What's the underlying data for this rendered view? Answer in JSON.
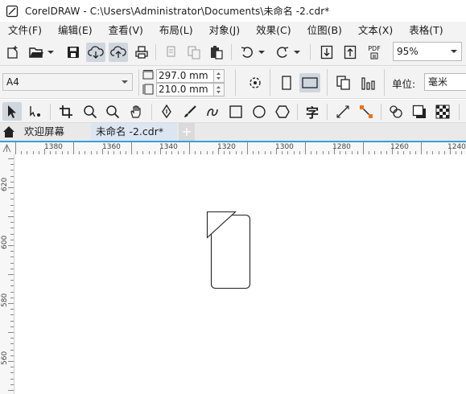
{
  "window": {
    "title": "CorelDRAW - C:\\Users\\Administrator\\Documents\\未命名 -2.cdr*"
  },
  "menu": [
    {
      "label": "文件(F)"
    },
    {
      "label": "编辑(E)"
    },
    {
      "label": "查看(V)"
    },
    {
      "label": "布局(L)"
    },
    {
      "label": "对象(J)"
    },
    {
      "label": "效果(C)"
    },
    {
      "label": "位图(B)"
    },
    {
      "label": "文本(X)"
    },
    {
      "label": "表格(T)"
    }
  ],
  "toolbar": {
    "zoom_value": "95%",
    "pdf_label": "PDF"
  },
  "propbar": {
    "page_size": "A4",
    "width": "297.0 mm",
    "height": "210.0 mm",
    "units_label": "单位:",
    "units_value": "毫米"
  },
  "toolbox": {
    "text_tool_glyph": "字"
  },
  "tabs": {
    "welcome": "欢迎屏幕",
    "doc": "未命名 -2.cdr*",
    "add": "+"
  },
  "ruler": {
    "h_labels": [
      "1380",
      "1360",
      "1340",
      "1320",
      "1300",
      "1280",
      "1260",
      "1240"
    ],
    "v_labels": [
      "620",
      "600",
      "580",
      "560"
    ]
  },
  "colors": {
    "accent": "#3aa0d8",
    "pressed": "#cfd6de",
    "tab_active": "#dce6f3"
  }
}
